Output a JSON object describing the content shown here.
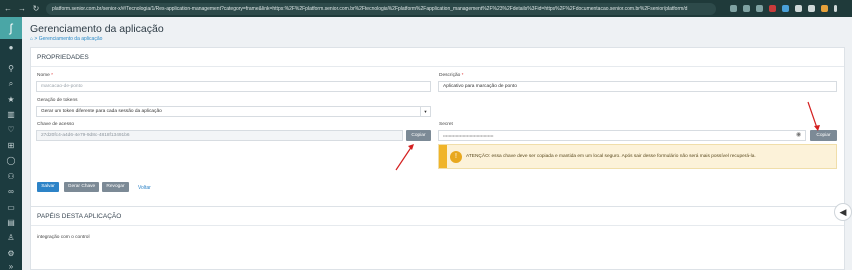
{
  "browser": {
    "url": "platform.senior.com.br/senior-x/#/Tecnologia/1/Res-application-management?category=frame&link=https:%2F%2Fplatform.senior.com.br%2Ftecnologia%2Fplatform%2Fapplication_management%2F%23%2Fdetails%3Fid=https%2F%2Fdocumentacao.senior.com.br%2Fsenior/platform/d",
    "url_host": "platform.senior.com.br"
  },
  "page": {
    "title": "Gerenciamento da aplicação",
    "breadcrumb": "Gerenciamento da aplicação"
  },
  "props": {
    "heading": "PROPRIEDADES",
    "nome_label": "Nome",
    "nome_placeholder": "marcacao-de-ponto",
    "descricao_label": "Descrição",
    "descricao_value": "Aplicativo para marcação de ponto",
    "geracao_label": "Geração de tokens",
    "geracao_value": "Gerar um token diferente para cada sessão da aplicação",
    "chave_label": "Chave de acesso",
    "chave_value": "27d20fc4-a4d6-4e79-9d8c-4818f13491b6",
    "copy1": "Copiar",
    "secret_label": "Secret",
    "secret_value": "••••••••••••••••••••••••••••••••••••",
    "copy2": "Copiar",
    "warning": "ATENÇÃO: essa chave deve ser copiada e mantida em um local seguro. Após sair desse formulário não será mais possível recuperá-la."
  },
  "actions": {
    "save": "Salvar",
    "generate": "Gerar Chave",
    "revoke": "Revogar",
    "cancel": "Voltar"
  },
  "roles": {
    "heading": "PAPÉIS DESTA APLICAÇÃO",
    "item": "integração com o control"
  },
  "colors": {
    "accent": "#2d83c7",
    "sidebar": "#1c3b3f",
    "warning": "#f0b429",
    "arrow": "#d42020"
  }
}
